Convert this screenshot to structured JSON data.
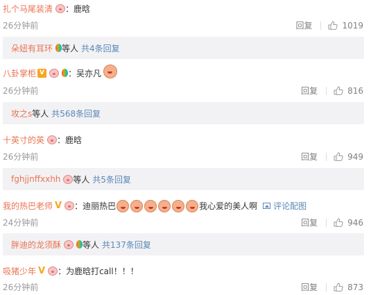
{
  "comments": [
    {
      "user": "扎个马尾装清",
      "text": "：鹿晗",
      "time": "26分钟前",
      "reply_label": "回复",
      "likes": "1019",
      "sub": {
        "user": "朵妞有耳环",
        "middle": "等人",
        "more": "共4条回复"
      }
    },
    {
      "user": "八卦掌柜",
      "text": "：吴亦凡",
      "time": "26分钟前",
      "reply_label": "回复",
      "likes": "816",
      "sub": {
        "user": "攻之s",
        "middle": "等人",
        "more": "共568条回复"
      }
    },
    {
      "user": "十英寸的英",
      "text": "：鹿晗",
      "time": "26分钟前",
      "reply_label": "回复",
      "likes": "949",
      "sub": {
        "user": "fghjjnffxxhh",
        "middle": "等人",
        "more": "共5条回复"
      }
    },
    {
      "user": "我的热巴老师",
      "text": "：迪丽热巴",
      "text2": "我心爱的美人啊",
      "image_link": "评论配图",
      "time": "24分钟前",
      "reply_label": "回复",
      "likes": "946",
      "sub": {
        "user": "胖迪的龙须酥",
        "middle": "等人",
        "more": "共137条回复"
      }
    },
    {
      "user": "吸猪少年",
      "text": "：为鹿晗打call！！！",
      "time": "26分钟前",
      "reply_label": "回复",
      "likes": "873"
    }
  ],
  "colors": {
    "username": "#eb7350",
    "link": "#5b87b5",
    "meta": "#999999",
    "subbox_bg": "#f2f2f5"
  },
  "icons": {
    "like": "thumbs-up-icon",
    "badge_pig": "pig-face-icon",
    "badge_balloon": "rainbow-balloon-icon",
    "badge_vip": "vip-badge-icon",
    "emoji": "emoji-face-icon"
  }
}
